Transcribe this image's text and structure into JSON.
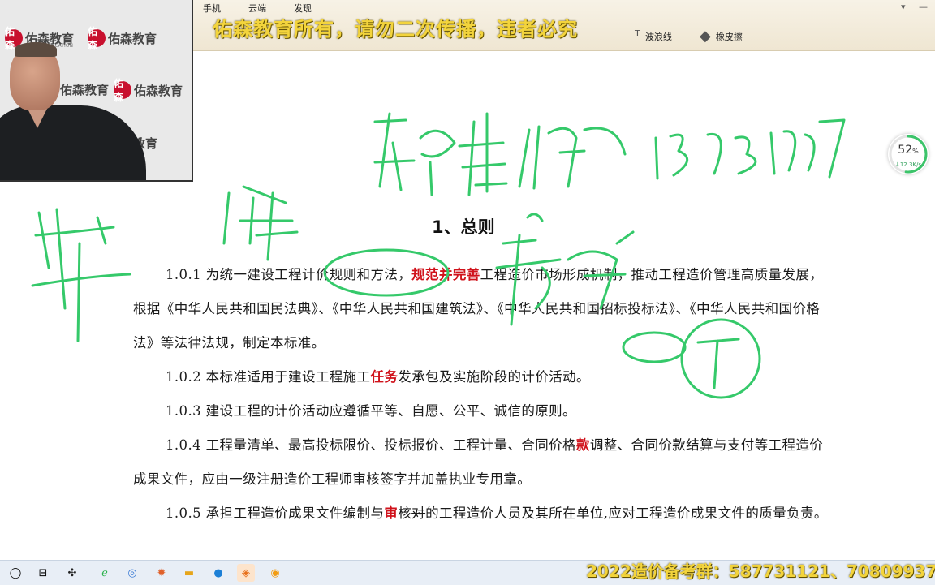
{
  "watermark_banner": "佑森教育所有，请勿二次传播，违者必究",
  "top_menu": [
    "手机",
    "云端",
    "发现"
  ],
  "toolbar_tools": [
    {
      "icon": "wave-line-icon",
      "label": "波浪线"
    },
    {
      "icon": "eraser-icon",
      "label": "橡皮擦"
    }
  ],
  "webcam": {
    "logo_text": "佑森教育",
    "logo_sub": "YOSUN EDUCATION",
    "logo_seal": "佑森"
  },
  "document": {
    "heading": "1、总则",
    "paragraphs": [
      {
        "num": "1.0.1",
        "parts": [
          {
            "t": "为统一建设工程计价规则和方法，"
          },
          {
            "t": "规范并完善",
            "red": true
          },
          {
            "t": "工程造价市场形成机制，推动工程造价管理高质量发展，根据《中华人民共和国民法典》、《中华人民共和国建筑法》、《中华人民共和国招标投标法》、《中华人民共和国价格法》等法律法规，制定本标准。"
          }
        ]
      },
      {
        "num": "1.0.2",
        "parts": [
          {
            "t": "本标准适用于建设工程施工"
          },
          {
            "t": "任务",
            "red": true
          },
          {
            "t": "发承包及实施阶段的计价活动。"
          }
        ]
      },
      {
        "num": "1.0.3",
        "parts": [
          {
            "t": "建设工程的计价活动应遵循平等、自愿、公平、诚信的原则。"
          }
        ]
      },
      {
        "num": "1.0.4",
        "parts": [
          {
            "t": "工程量清单、最高投标限价、投标报价、工程计量、合同价"
          },
          {
            "t": "格",
            "strike": true
          },
          {
            "t": "款",
            "red": true
          },
          {
            "t": "调整、合同价款结算与支付等工程造价成果文件，应由一级注册造价工程师审核签字并加盖执业专用章。"
          }
        ]
      },
      {
        "num": "1.0.5",
        "parts": [
          {
            "t": "承担工程造价成果文件编制与"
          },
          {
            "t": "审",
            "red": true
          },
          {
            "t": "核"
          },
          {
            "t": "对",
            "strike": true
          },
          {
            "t": "的工程造价人员及其所在单位,应对工程造价成果文件的质量负责。"
          }
        ]
      }
    ]
  },
  "speed_widget": {
    "percent": "52",
    "percent_sign": "%",
    "rate": "↓12.3K/s",
    "ring_fraction": 0.52
  },
  "group_bar": "2022造价备考群：587731121、70809937",
  "colors": {
    "ink": "#35c96a",
    "red_text": "#d0121b",
    "banner": "#f3d43c"
  },
  "taskbar_icons": [
    "start-circle-icon",
    "task-view-icon",
    "pinwheel-icon",
    "edge-browser-icon",
    "chrome-icon",
    "gear-app-icon",
    "folder-icon",
    "blue-dot-app-icon",
    "orange-app-icon",
    "orange-circle-app-icon"
  ]
}
